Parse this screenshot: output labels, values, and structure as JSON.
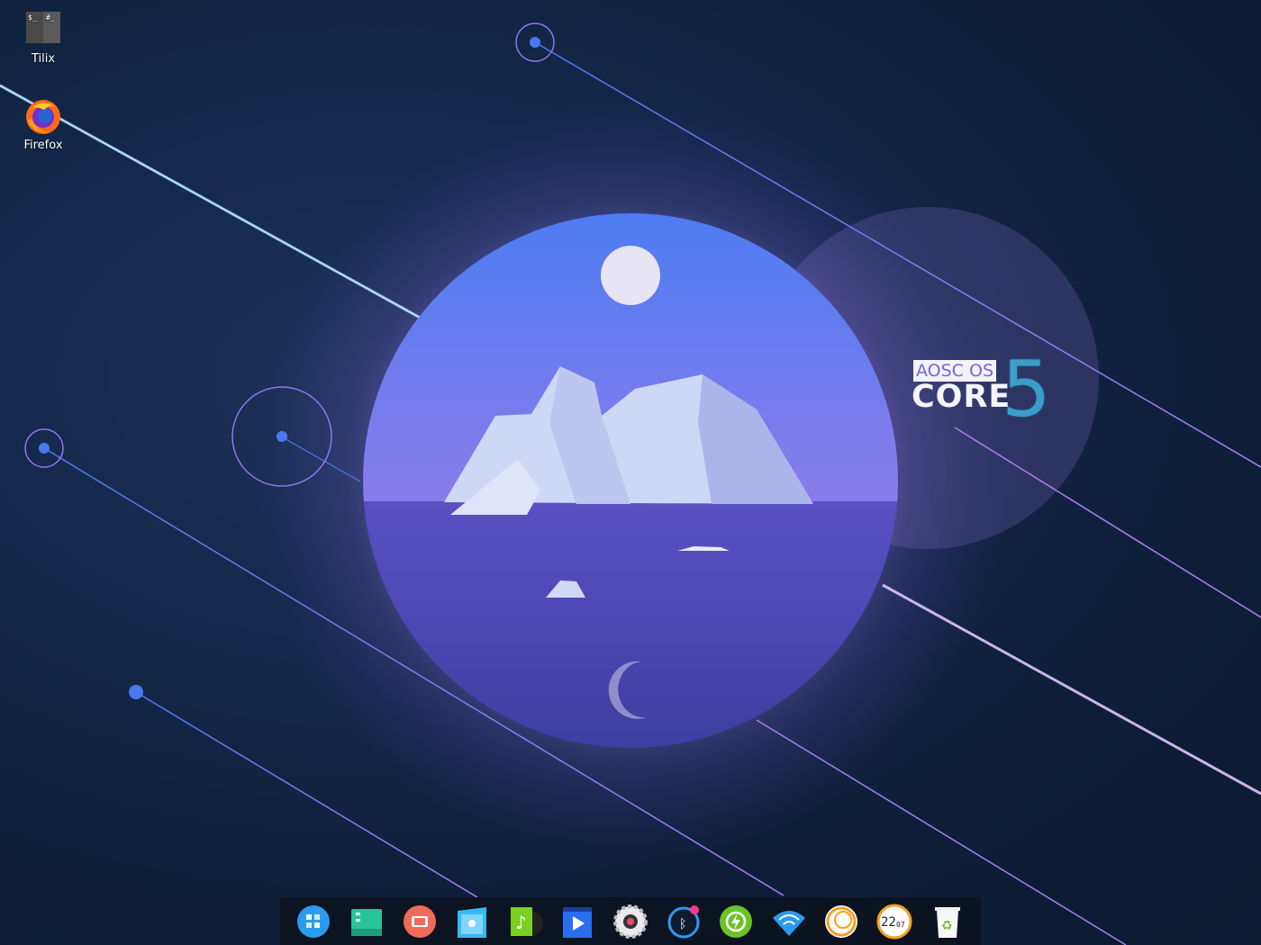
{
  "desktop": {
    "icons": [
      {
        "label": "Tilix",
        "icon": "terminal-icon",
        "glyph_left": "$_",
        "glyph_right": "#_"
      },
      {
        "label": "Firefox",
        "icon": "firefox-icon"
      }
    ]
  },
  "wallpaper": {
    "logo_line1": "AOSC OS",
    "logo_line2": "CORE",
    "logo_version": "5"
  },
  "dock": {
    "items": [
      {
        "name": "launcher",
        "icon": "launcher-grid-icon"
      },
      {
        "name": "file-manager",
        "icon": "file-manager-icon"
      },
      {
        "name": "screenshot",
        "icon": "screen-recorder-icon"
      },
      {
        "name": "store",
        "icon": "app-store-icon"
      },
      {
        "name": "music",
        "icon": "music-icon"
      },
      {
        "name": "video",
        "icon": "movie-icon"
      },
      {
        "name": "settings",
        "icon": "settings-gear-icon"
      },
      {
        "name": "bluetooth",
        "icon": "bluetooth-icon"
      },
      {
        "name": "power",
        "icon": "power-icon"
      },
      {
        "name": "wifi",
        "icon": "wifi-icon"
      },
      {
        "name": "shutdown",
        "icon": "shutdown-icon"
      },
      {
        "name": "clock",
        "icon": "clock-icon",
        "time_hours": "22",
        "time_minutes": "07"
      },
      {
        "name": "trash",
        "icon": "trash-icon"
      }
    ]
  },
  "colors": {
    "accent": "#4a7af0",
    "purple": "#a781f5",
    "dock_bg": "#0c121e"
  }
}
